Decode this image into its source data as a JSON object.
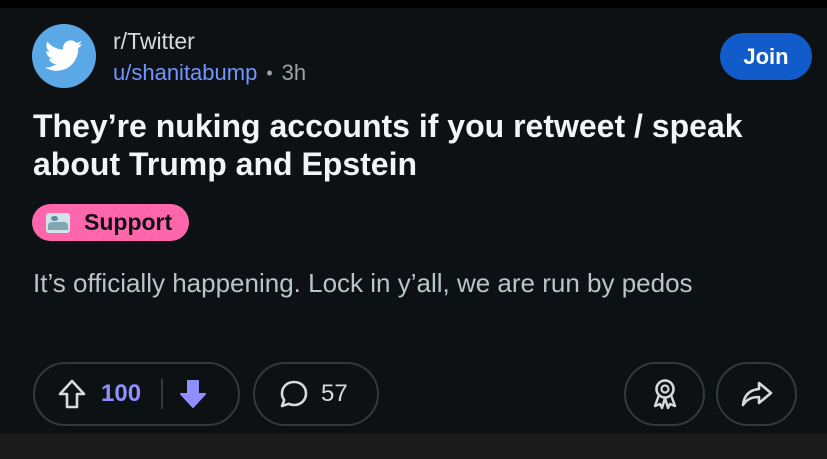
{
  "post": {
    "subreddit": "r/Twitter",
    "author": "u/shanitabump",
    "separator": "•",
    "age": "3h",
    "join_label": "Join",
    "title": "They’re nuking accounts if you retweet / speak about Trump and Epstein",
    "flair": {
      "label": "Support",
      "color": "#ff66ac",
      "icon": "landscape-emoji-icon"
    },
    "body": "It’s officially happening. Lock in y’all, we are run by pedos"
  },
  "actions": {
    "vote_count": "100",
    "upvote_icon": "arrow-up-icon",
    "downvote_icon": "arrow-down-filled-icon",
    "comment_count": "57",
    "comment_icon": "speech-bubble-icon",
    "award_icon": "award-icon",
    "share_icon": "share-icon"
  },
  "colors": {
    "background": "#0e1113",
    "accent_blue": "#115bca",
    "username": "#7196ff",
    "vote_active": "#8f8fff",
    "subreddit_icon_bg": "#5aa9e6"
  }
}
